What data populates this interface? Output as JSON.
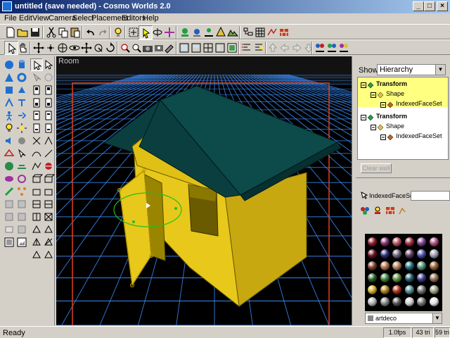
{
  "window": {
    "title": "untitled (save needed) - Cosmo Worlds 2.0"
  },
  "menu": {
    "items": [
      "File",
      "Edit",
      "View",
      "Camera",
      "Select",
      "Placement",
      "Editors",
      "Help"
    ]
  },
  "viewport": {
    "label": "Room"
  },
  "scene_panel": {
    "show_label": "Show:",
    "show_value": "Hierarchy",
    "tree": [
      {
        "label": "Transform",
        "depth": 0,
        "bold": true
      },
      {
        "label": "Shape",
        "depth": 1,
        "bold": false
      },
      {
        "label": "IndexedFaceSet",
        "depth": 2,
        "bold": false
      },
      {
        "label": "Transform",
        "depth": 0,
        "bold": true
      },
      {
        "label": "Shape",
        "depth": 1,
        "bold": false
      },
      {
        "label": "IndexedFaceSet",
        "depth": 2,
        "bold": false
      }
    ],
    "clear_button": "Clear well"
  },
  "material_panel": {
    "node_label": "IndexedFaceSet",
    "library_value": "artdeco",
    "swatch_colors": [
      [
        "#8b1a2a",
        "#7a2b6a",
        "#b04a5a",
        "#a02a3a",
        "#7a3a8a",
        "#a84a7a"
      ],
      [
        "#6a1020",
        "#2a2a7a",
        "#6a5a7a",
        "#5a3a5a",
        "#4a4aaa",
        "#9a9ab0"
      ],
      [
        "#7a3a2a",
        "#aa6a4a",
        "#aa7a5a",
        "#1a6a7a",
        "#4a8a6a",
        "#8a5a2a"
      ],
      [
        "#2a5a2a",
        "#3a7a3a",
        "#5a8a3a",
        "#1a5a6a",
        "#3a3a8a",
        "#8a6a4a"
      ],
      [
        "#ccaa20",
        "#aa7a10",
        "#aa2a10",
        "#4a8a8a",
        "#6a6a6a",
        "#9a9a7a"
      ],
      [
        "#b0b0b0",
        "#808080",
        "#505050",
        "#cccccc",
        "#707070",
        "#e0e0e0"
      ]
    ]
  },
  "status": {
    "text": "Ready",
    "fps": "1.0fps",
    "tris": "43 tri",
    "tris2": "59 tri"
  },
  "colors": {
    "roof": "#0d4a4a",
    "wall_front": "#e8c81a",
    "wall_side": "#c8a810",
    "grid": "#3a90ff",
    "selection_box": "#e04020"
  }
}
